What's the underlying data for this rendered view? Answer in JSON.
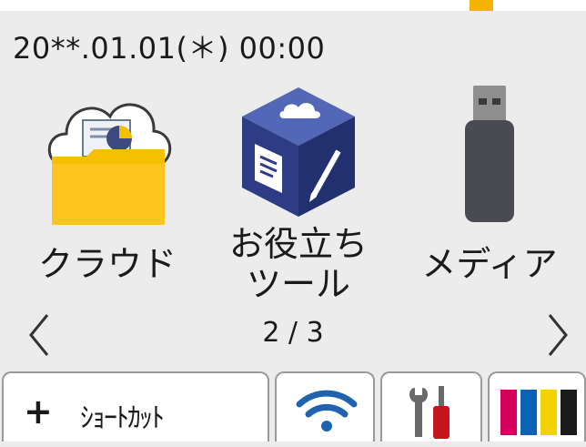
{
  "status": {
    "datetime": "20**.01.01(＊)  00:00"
  },
  "apps": [
    {
      "label": "クラウド"
    },
    {
      "label_line1": "お役立ち",
      "label_line2": "ツール"
    },
    {
      "label": "メディア"
    }
  ],
  "pager": {
    "text": "2 / 3"
  },
  "bottom_bar": {
    "shortcut_label": "ｼｮｰﾄｶｯﾄ",
    "shortcut_plus": "+"
  },
  "colors": {
    "folder": "#f5c000",
    "tools_cube": "#2e3c86",
    "usb": "#4a4a52",
    "ink_magenta": "#d6005c",
    "ink_cyan": "#0d62b5",
    "ink_yellow": "#f4d100",
    "ink_black": "#1b1b1b"
  }
}
